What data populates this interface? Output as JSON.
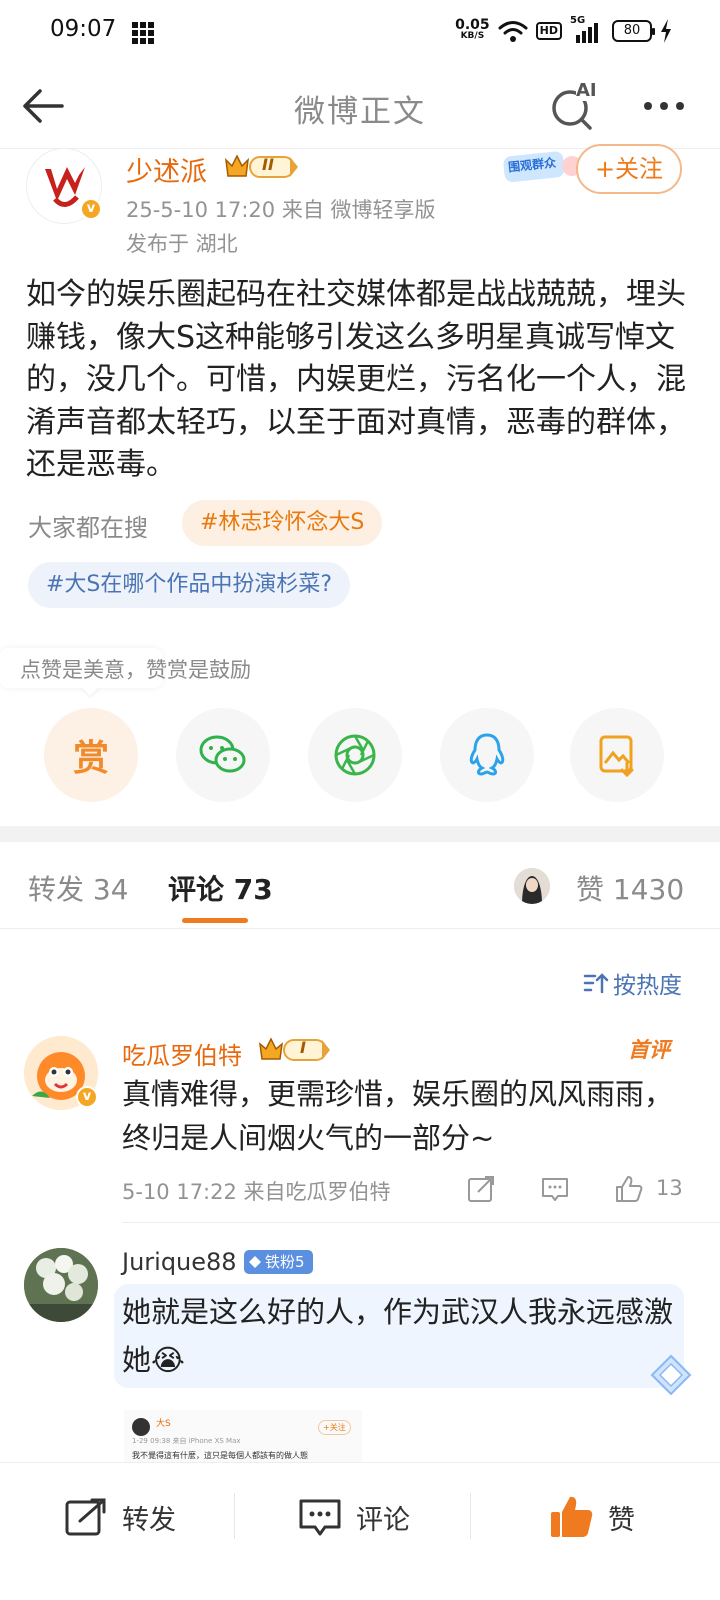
{
  "status_bar": {
    "time": "09:07",
    "net_speed_value": "0.05",
    "net_speed_unit": "KB/S",
    "hd": "HD",
    "network": "5G",
    "battery": "80"
  },
  "nav": {
    "title": "微博正文",
    "ai_label": "AI"
  },
  "post": {
    "author": "少述派",
    "level_badge": "II",
    "meta": "25-5-10 17:20  来自 微博轻享版",
    "location": "发布于 湖北",
    "follow_label": "+关注",
    "promo_sticker": "围观群众",
    "text": "如今的娱乐圈起码在社交媒体都是战战兢兢，埋头赚钱，像大S这种能够引发这么多明星真诚写悼文的，没几个。可惜，内娱更烂，污名化一个人，混淆声音都太轻巧，以至于面对真情，恶毒的群体，还是恶毒。",
    "search_label": "大家都在搜",
    "topics": [
      "#林志玲怀念大S",
      "#大S在哪个作品中扮演杉菜?"
    ],
    "reward_hint": "点赞是美意，赞赏是鼓励",
    "reward_char": "赏",
    "share_icons": [
      "reward-icon",
      "wechat-icon",
      "moments-icon",
      "qq-icon",
      "save-image-icon"
    ]
  },
  "tabs": {
    "repost": "转发 34",
    "comment": "评论 73",
    "like": "赞 1430"
  },
  "sort_label": "按热度",
  "comments": [
    {
      "name": "吃瓜罗伯特",
      "level_badge": "I",
      "first_badge": "首评",
      "text": "真情难得，更需珍惜，娱乐圈的风风雨雨，终归是人间烟火气的一部分~",
      "meta": "5-10 17:22  来自吃瓜罗伯特",
      "likes": "13"
    },
    {
      "name": "Jurique88",
      "fan_badge": "铁粉5",
      "text": "她就是这么好的人，作为武汉人我永远感激她😭",
      "embed": {
        "name": "大S",
        "time": "1-29 09:38 来自 iPhone XS Max",
        "text": "我不覺得這有什麼，這只是每個人都該有的做人態",
        "follow": "+关注"
      }
    }
  ],
  "bottom_bar": {
    "repost": "转发",
    "comment": "评论",
    "like": "赞"
  },
  "colors": {
    "accent_orange": "#e8690c",
    "link_blue": "#4a74b4",
    "meta_gray": "#939393"
  }
}
